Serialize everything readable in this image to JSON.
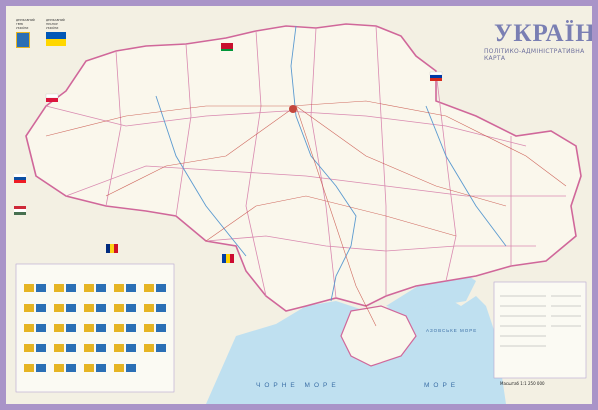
{
  "map": {
    "title": "УКРАЇНА",
    "subtitle": "ПОЛІТИКО-АДМІНІСТРАТИВНА КАРТА",
    "sea_labels": {
      "black_sea": "ЧОРНЕ   МОРЕ",
      "black_sea_2": "МОРЕ",
      "azov_sea": "АЗОВСЬКЕ МОРЕ"
    },
    "state_symbols": {
      "coat_caption": "ДЕРЖАВНИЙ ГЕРБ УКРАЇНИ",
      "flag_caption": "ДЕРЖАВНИЙ ПРАПОР УКРАЇНИ"
    },
    "scale": "Масштаб 1:1 250 000",
    "colors": {
      "frame": "#a994c8",
      "land": "#f6f3e8",
      "sea": "#bfe0f0",
      "border": "#d0679a",
      "rivers": "#5c9bd0",
      "roads": "#c4463c"
    }
  }
}
